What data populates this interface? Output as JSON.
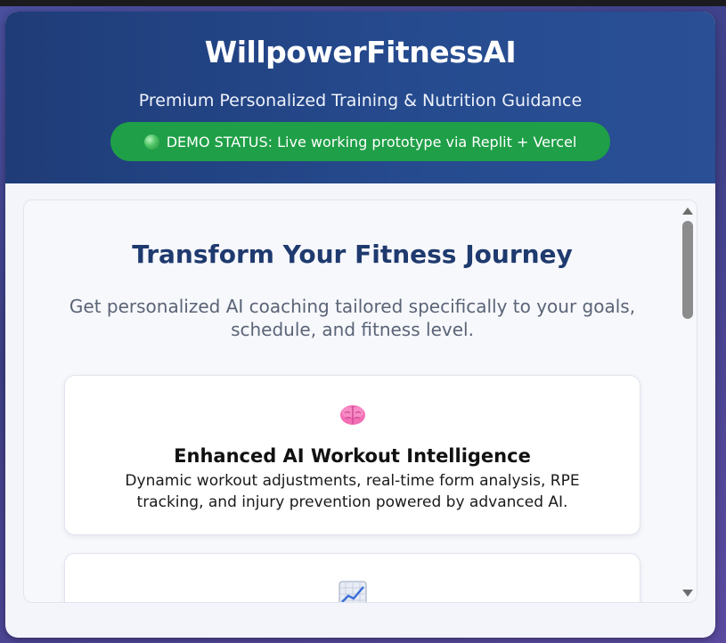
{
  "header": {
    "title": "WillpowerFitnessAI",
    "subtitle": "Premium Personalized Training & Nutrition Guidance",
    "status": "DEMO STATUS: Live working prototype via Replit + Vercel",
    "status_color": "#1f9f47",
    "background_color": "#264b8f"
  },
  "hero": {
    "headline": "Transform Your Fitness Journey",
    "description": "Get personalized AI coaching tailored specifically to your goals, schedule, and fitness level."
  },
  "features": [
    {
      "icon": "brain-icon",
      "title": "Enhanced AI Workout Intelligence",
      "description": "Dynamic workout adjustments, real-time form analysis, RPE tracking, and injury prevention powered by advanced AI."
    },
    {
      "icon": "chart-increasing-icon",
      "title": "",
      "description": ""
    }
  ],
  "scrollbar": {
    "position_fraction": 0.0
  }
}
